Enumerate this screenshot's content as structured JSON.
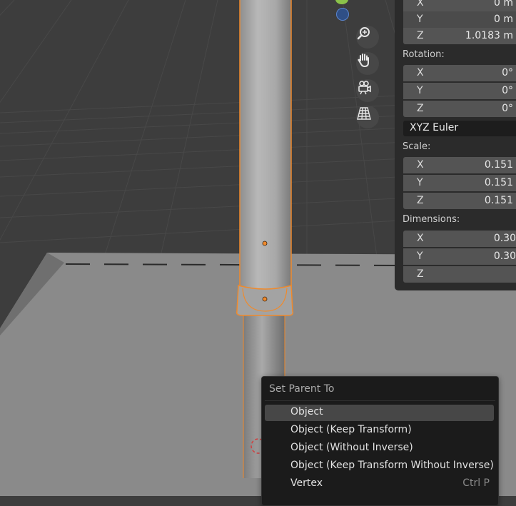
{
  "npanel": {
    "location_rows": [
      {
        "axis": "X",
        "value": "0 m"
      },
      {
        "axis": "Y",
        "value": "0 m"
      },
      {
        "axis": "Z",
        "value": "1.0183 m"
      }
    ],
    "rotation_label": "Rotation:",
    "rotation_rows": [
      {
        "axis": "X",
        "value": "0°"
      },
      {
        "axis": "Y",
        "value": "0°"
      },
      {
        "axis": "Z",
        "value": "0°"
      }
    ],
    "rotation_mode": "XYZ Euler",
    "scale_label": "Scale:",
    "scale_rows": [
      {
        "axis": "X",
        "value": "0.151"
      },
      {
        "axis": "Y",
        "value": "0.151"
      },
      {
        "axis": "Z",
        "value": "0.151"
      }
    ],
    "dimensions_label": "Dimensions:",
    "dimensions_rows": [
      {
        "axis": "X",
        "value": "0.30"
      },
      {
        "axis": "Y",
        "value": "0.30"
      },
      {
        "axis": "Z",
        "value": ""
      }
    ]
  },
  "menu": {
    "title": "Set Parent To",
    "items": [
      {
        "label": "Object",
        "shortcut": ""
      },
      {
        "label": "Object (Keep Transform)",
        "shortcut": ""
      },
      {
        "label": "Object (Without Inverse)",
        "shortcut": ""
      },
      {
        "label": "Object (Keep Transform Without Inverse)",
        "shortcut": ""
      },
      {
        "label": "Vertex",
        "shortcut": "Ctrl P"
      }
    ]
  },
  "nav": {
    "icons": [
      "zoom-icon",
      "hand-pan-icon",
      "camera-icon",
      "grid-perspective-icon"
    ]
  },
  "colors": {
    "selection_outline": "#f08a2c",
    "axis_y": "#8bc34a",
    "axis_z": "#3f69b5",
    "background": "#3d3d3d"
  }
}
